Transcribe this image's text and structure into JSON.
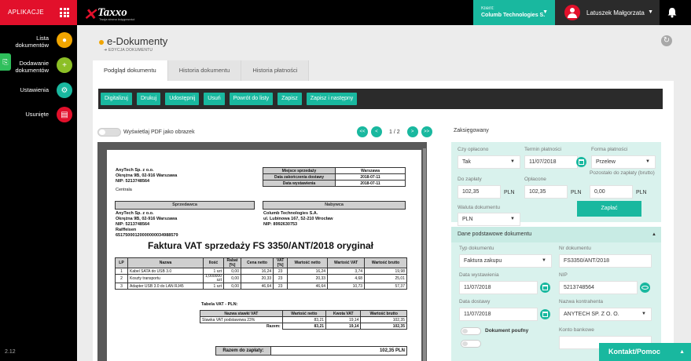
{
  "topbar": {
    "apps_label": "APLIKACJE",
    "logo_name": "Taxxo",
    "logo_tagline": "Twoja strona księgowości",
    "client_label": "Klient:",
    "client_value": "Columb Technologies S.",
    "user_name": "Latuszek Małgorzata"
  },
  "sidebar": {
    "items": [
      {
        "label": "Lista dokumentów",
        "color": "#f0a500"
      },
      {
        "label": "Dodawanie dokumentów",
        "color": "#8cbf26"
      },
      {
        "label": "Ustawienia",
        "color": "#19b89f"
      },
      {
        "label": "Usunięte",
        "color": "#e2102b"
      }
    ],
    "version": "2.12"
  },
  "page": {
    "title": "e-Dokumenty",
    "breadcrumb": "EDYCJA DOKUMENTU"
  },
  "tabs": [
    "Podgląd dokumentu",
    "Historia dokumentu",
    "Historia płatności"
  ],
  "toolbar": [
    "Digitalizuj",
    "Drukuj",
    "Udostępnij",
    "Usuń",
    "Powrót do listy",
    "Zapisz",
    "Zapisz i następny"
  ],
  "viewer": {
    "toggle_label": "Wyświetlaj PDF jako obrazek",
    "page_current": "1",
    "page_separator": "/",
    "page_total": "2",
    "first": "<<",
    "prev": "<",
    "next": ">",
    "last": ">>"
  },
  "invoice": {
    "seller_top": [
      "AnyTech Sp. z o.o.",
      "Okrężna 9B, 02-916 Warszawa",
      "NIP: 5213748564"
    ],
    "centrala": "Centrala",
    "place_label": "Miejsce sprzedaży",
    "place_value": "Warszawa",
    "delivery_label": "Data zakończenia dostawy",
    "delivery_value": "2018-07-11",
    "issue_label": "Data wystawienia",
    "issue_value": "2018-07-11",
    "seller_head": "Sprzedawca",
    "seller": [
      "AnyTech Sp. z o.o.",
      "Okrężna 9B, 02-916 Warszawa",
      "NIP: 5213748564",
      "Raiffeisen",
      "65175000120000000034988579"
    ],
    "buyer_head": "Nabywca",
    "buyer": [
      "Columb Technologies S.A.",
      "ul. Lubinowa 167, 52-210 Wrocław",
      "NIP: 8992630753"
    ],
    "title": "Faktura VAT sprzedaży FS 3350/ANT/2018 oryginał",
    "items_header": [
      "LP",
      "Nazwa",
      "Ilość",
      "Rabat [%]",
      "Cena netto",
      "VAT [%]",
      "Wartość netto",
      "Wartość VAT",
      "Wartość brutto"
    ],
    "items": [
      [
        "1",
        "Kabel SATA do USB 3.0",
        "1 szt",
        "0,00",
        "16,24",
        "23",
        "16,24",
        "3,74",
        "19,98"
      ],
      [
        "2",
        "Koszty transportu",
        "1,000000 szt",
        "0,00",
        "20,33",
        "23",
        "20,33",
        "4,68",
        "25,01"
      ],
      [
        "3",
        "Adapter USB 3.0 do LAN RJ45",
        "1 szt",
        "0,00",
        "46,64",
        "23",
        "46,64",
        "10,73",
        "57,37"
      ]
    ],
    "vat_table_label": "Tabela VAT - PLN:",
    "vat_header": [
      "Nazwa stawki VAT",
      "Wartość netto",
      "Kwota VAT",
      "Wartość brutto"
    ],
    "vat_row": [
      "Stawka VAT podstawowa 23%",
      "83,21",
      "19,14",
      "102,35"
    ],
    "sum_label": "Razem:",
    "sum_row": [
      "83,21",
      "19,14",
      "102,35"
    ],
    "to_pay_label": "Razem do zapłaty:",
    "to_pay_value": "102,35 PLN"
  },
  "settlement": {
    "title": "Zaksięgowany",
    "paid_label": "Czy opłacono",
    "paid_value": "Tak",
    "due_label": "Termin płatności",
    "due_value": "11/07/2018",
    "form_label": "Forma płatności",
    "form_value": "Przelew",
    "to_pay_label": "Do zapłaty",
    "to_pay_value": "102,35",
    "paid_amt_label": "Opłacone",
    "paid_amt_value": "102,35",
    "left_label": "Pozostało do zapłaty (brutto)",
    "left_value": "0,00",
    "currency_unit": "PLN",
    "currency_label": "Waluta dokumentu",
    "currency_value": "PLN",
    "pay_button": "Zapłać"
  },
  "basic": {
    "header": "Dane podstawowe dokumentu",
    "type_label": "Typ dokumentu",
    "type_value": "Faktura zakupu",
    "number_label": "Nr dokumentu",
    "number_value": "FS3350/ANT/2018",
    "issue_label": "Data wystawienia",
    "issue_value": "11/07/2018",
    "nip_label": "NIP",
    "nip_value": "5213748564",
    "delivery_label": "Data dostawy",
    "delivery_value": "11/07/2018",
    "contractor_label": "Nazwa kontrahenta",
    "contractor_value": "ANYTECH SP. Z O. O.",
    "doubtful_label": "Dokument poufny",
    "bank_label": "Konto bankowe"
  },
  "contact": "Kontakt/Pomoc"
}
